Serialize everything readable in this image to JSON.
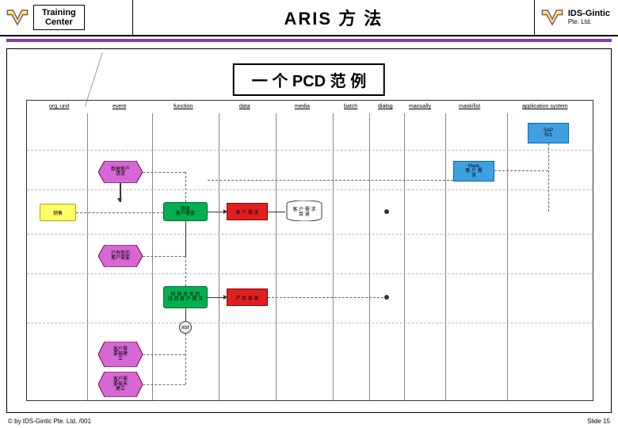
{
  "header": {
    "training_center": "Training\nCenter",
    "title": "ARIS  方 法",
    "ids": "IDS-Gintic",
    "pte": "Pte. Ltd."
  },
  "subtitle": "一 个 PCD 范 例",
  "columns": {
    "org_unit": "org. unit",
    "event": "event",
    "function": "function",
    "data": "data",
    "media": "media",
    "batch": "batch",
    "dialog": "dialog",
    "manually": "manually",
    "mask_list": "mask/list",
    "app_system": "application system"
  },
  "shapes": {
    "sap": "SAP\nR/3",
    "ev1": "数据客户\n请求",
    "ev2": "已有新的\n客户需要",
    "ev3": "客户需\n要被建\n立",
    "ev4": "客户需\n要被未\n建立",
    "fn1": "接收\n客户需求",
    "fn2": "检 核 无 关 的\n旧 目 客 户 需 求",
    "data1": "客 户 需 求",
    "data2": "产 品 目 录",
    "media1": "客 户 需 求\n目 录",
    "org1": "销售",
    "mask1": "Mask\n客 户 需\n求",
    "xor": "xor"
  },
  "footer": {
    "left": "© by IDS-Gintic Pte. Ltd. /001",
    "right": "Slide 15"
  }
}
